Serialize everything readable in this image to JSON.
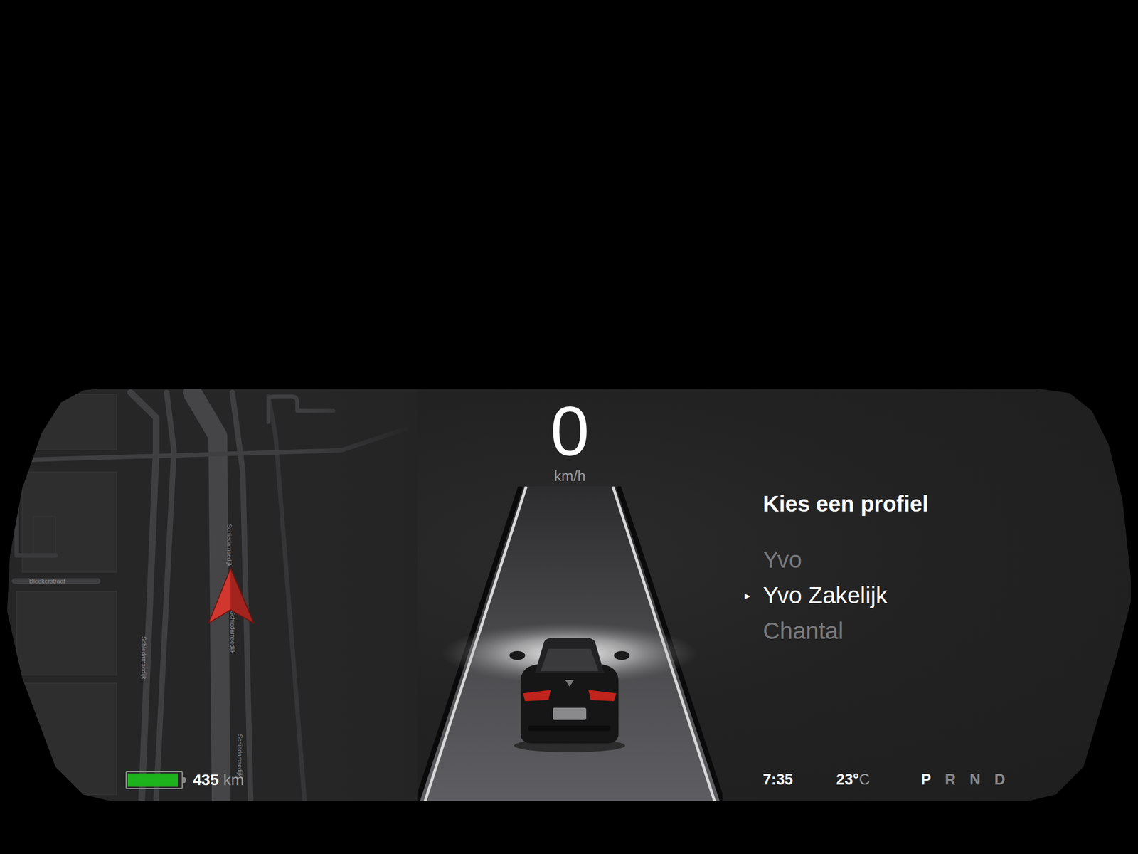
{
  "map": {
    "labels": [
      "Schiedamsedijk",
      "Schiedamsedijk",
      "Schiedamsedijk",
      "Schiedamsedijk",
      "Bleekerstraat"
    ]
  },
  "speed": {
    "value": "0",
    "unit": "km/h"
  },
  "profile_menu": {
    "title": "Kies een profiel",
    "marker": "▸",
    "items": [
      {
        "label": "Yvo",
        "selected": false
      },
      {
        "label": "Yvo Zakelijk",
        "selected": true
      },
      {
        "label": "Chantal",
        "selected": false
      }
    ]
  },
  "battery": {
    "level": 0.95,
    "range": "435",
    "unit": "km"
  },
  "status": {
    "time": "7:35",
    "temperature": "23°",
    "temperature_unit": "C",
    "gears": [
      {
        "label": "P",
        "selected": true
      },
      {
        "label": "R",
        "selected": false
      },
      {
        "label": "N",
        "selected": false
      },
      {
        "label": "D",
        "selected": false
      }
    ]
  }
}
